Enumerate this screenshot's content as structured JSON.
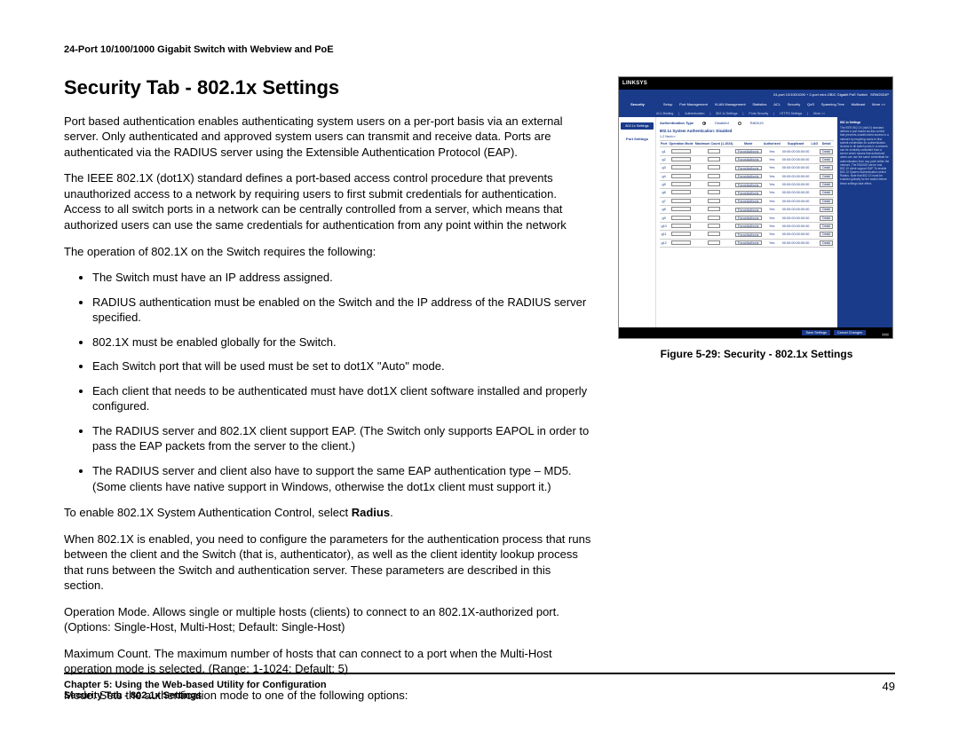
{
  "doc_header": "24-Port 10/100/1000 Gigabit Switch with Webview and PoE",
  "heading": "Security Tab - 802.1x Settings",
  "p1": "Port based authentication enables authenticating system users on a per-port basis via an external server. Only authenticated and approved system users can transmit and receive data. Ports are authenticated via the RADIUS server using the Extensible Authentication Protocol (EAP).",
  "p2": "The IEEE 802.1X (dot1X) standard defines a port-based access control procedure that prevents unauthorized access to a network by requiring users to first submit credentials for authentication. Access to all switch ports in a network can be centrally controlled from a server, which means that authorized users can use the same credentials for authentication from any point within the network",
  "p3": "The operation of 802.1X on the Switch requires the following:",
  "bullets": [
    "The Switch must have an IP address assigned.",
    "RADIUS authentication must be enabled on the Switch and the IP address of the RADIUS server specified.",
    "802.1X must be enabled globally for the Switch.",
    "Each Switch port that will be used must be set to dot1X \"Auto\" mode.",
    "Each client that needs to be authenticated must have dot1X client software installed and properly configured.",
    "The RADIUS server and 802.1X client support EAP. (The Switch only supports EAPOL in order to pass the EAP packets from the server to the client.)",
    "The RADIUS server and client also have to support the same EAP authentication type – MD5. (Some clients have native support in Windows, otherwise the dot1x client must support it.)"
  ],
  "p4a": "To enable 802.1X System Authentication Control, select ",
  "p4b": "Radius",
  "p4c": ".",
  "p5": "When 802.1X is enabled, you need to configure the parameters for the authentication process that runs between the client and the Switch (that is, authenticator), as well as the client identity lookup process that runs between the Switch and authentication server. These parameters are described in this section.",
  "p6": "Operation Mode. Allows single or multiple hosts (clients) to connect to an 802.1X-authorized port. (Options: Single-Host, Multi-Host; Default: Single-Host)",
  "p7": "Maximum Count. The maximum number of hosts that can connect to a port when the Multi-Host operation mode is selected. (Range: 1-1024; Default: 5)",
  "p8": "Mode. Sets the authentication mode to one of the following options:",
  "figure": {
    "brand": "LINKSYS",
    "titlebar": "24-port 10/100/1000 + 2-port mini-GBIC Gigabit PoE Switch",
    "model": "SRW2024P",
    "section": "Security",
    "tabs": [
      "Setup",
      "Port Management",
      "VLAN Management",
      "Statistics",
      "ACL",
      "Security",
      "QoS",
      "Spanning Tree",
      "Multicast",
      "More >>"
    ],
    "subnav": [
      "ACL Binding",
      "|",
      "Authentication",
      "|",
      "802.1x Settings",
      "|",
      "Ports Security",
      "|",
      "HTTPS Settings",
      "|",
      "More >>"
    ],
    "left_btn": "802.1x Settings",
    "left_lbl": "Port Settings",
    "auth_type_label": "Authentication Type",
    "radio1": "Disabled",
    "radio2": "RADIUS",
    "pager": "1-2   Next>>",
    "sys_auth": "802.1x System Authentication: Disabled",
    "th": [
      "Port",
      "Operation Mode",
      "Maximum Count (1-1024)",
      "Mode",
      "Authorized",
      "Supplicant",
      "LAG",
      "Detail"
    ],
    "ports": [
      "g1",
      "g2",
      "g3",
      "g4",
      "g5",
      "g6",
      "g7",
      "g8",
      "g9",
      "g10",
      "g11",
      "g12"
    ],
    "op_mode": "ForceAuthoriz",
    "mac": "00:00:00:00:00:00",
    "yes": "Yes",
    "detail": "Detail",
    "help_title": "802.1x Settings",
    "help_body": "The IEEE 802.1X (dot1X) standard defines a port based access control that prevents unauthorized access to a network by requiring users to first submit credentials for authentication. Access to all switch ports in a network can be centrally controlled from a server which means that authorized users can use the same credentials for authentication from any point within the network. The RADIUS server and 802.1X client support EAP. To enable 802.1X System Authentication select Radius. Note that 802.1X must be enabled globally for the switch before these settings take effect.",
    "btn_save": "Save Settings",
    "btn_cancel": "Cancel Changes"
  },
  "caption": "Figure 5-29: Security - 802.1x Settings",
  "footer": {
    "chapter": "Chapter 5: Using the Web-based Utility for Configuration",
    "section": "Security Tab - 802.1x Settings",
    "page": "49"
  }
}
